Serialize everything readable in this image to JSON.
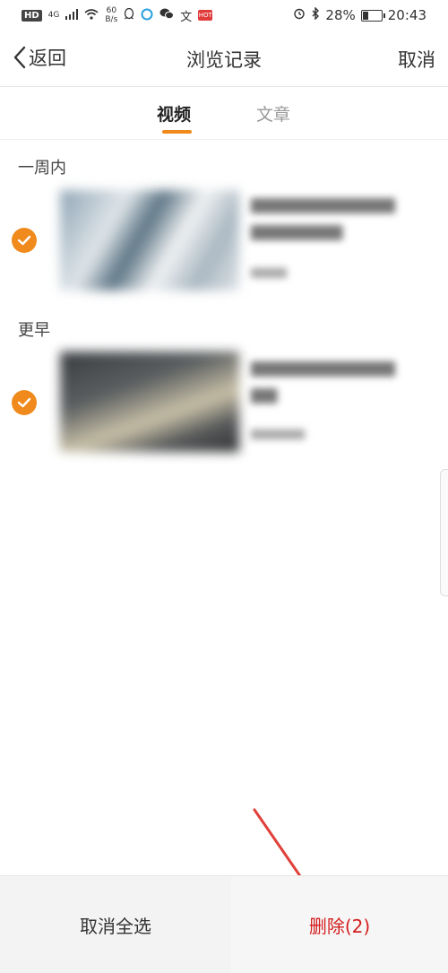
{
  "status_bar": {
    "hd": "HD",
    "network": "4G",
    "speed_value": "60",
    "speed_unit": "B/s",
    "mini_app": "HOT",
    "battery": "28%",
    "time": "20:43",
    "battery_level": 0.28
  },
  "nav": {
    "back_label": "返回",
    "title": "浏览记录",
    "cancel_label": "取消"
  },
  "tabs": [
    {
      "label": "视频",
      "active": true
    },
    {
      "label": "文章",
      "active": false
    }
  ],
  "sections": [
    {
      "label": "一周内",
      "items": [
        {
          "checked": true
        }
      ]
    },
    {
      "label": "更早",
      "items": [
        {
          "checked": true
        }
      ]
    }
  ],
  "bottom": {
    "select_all_cancel": "取消全选",
    "delete_label": "删除(2)"
  },
  "colors": {
    "accent": "#f08a1d",
    "delete": "#d51e1e",
    "arrow": "#e0403a"
  }
}
